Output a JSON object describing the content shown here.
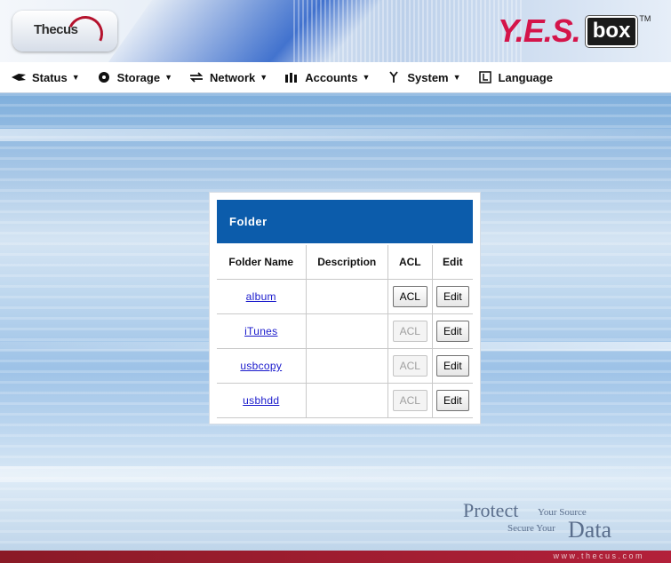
{
  "header": {
    "thecus_logo_text": "Thecus",
    "product_logo_yes": "Y.E.S.",
    "product_logo_box": "box",
    "product_logo_tm": "TM"
  },
  "menu": {
    "items": [
      {
        "label": "Status",
        "icon": "status-icon"
      },
      {
        "label": "Storage",
        "icon": "storage-icon"
      },
      {
        "label": "Network",
        "icon": "network-icon"
      },
      {
        "label": "Accounts",
        "icon": "accounts-icon"
      },
      {
        "label": "System",
        "icon": "system-icon"
      },
      {
        "label": "Language",
        "icon": "language-icon"
      }
    ]
  },
  "folder_panel": {
    "title": "Folder",
    "columns": [
      "Folder Name",
      "Description",
      "ACL",
      "Edit"
    ],
    "rows": [
      {
        "name": "album",
        "description": "",
        "acl_label": "ACL",
        "acl_enabled": true,
        "edit_label": "Edit"
      },
      {
        "name": "iTunes",
        "description": "",
        "acl_label": "ACL",
        "acl_enabled": false,
        "edit_label": "Edit"
      },
      {
        "name": "usbcopy",
        "description": "",
        "acl_label": "ACL",
        "acl_enabled": false,
        "edit_label": "Edit"
      },
      {
        "name": "usbhdd",
        "description": "",
        "acl_label": "ACL",
        "acl_enabled": false,
        "edit_label": "Edit"
      }
    ]
  },
  "slogan": {
    "protect": "Protect",
    "your_source": "Your Source",
    "secure_your": "Secure Your",
    "data": "Data"
  },
  "footer": {
    "url": "www.thecus.com"
  },
  "colors": {
    "panel_header": "#0c5cab",
    "footer": "#b3203a",
    "logo_accent": "#d4144a"
  }
}
